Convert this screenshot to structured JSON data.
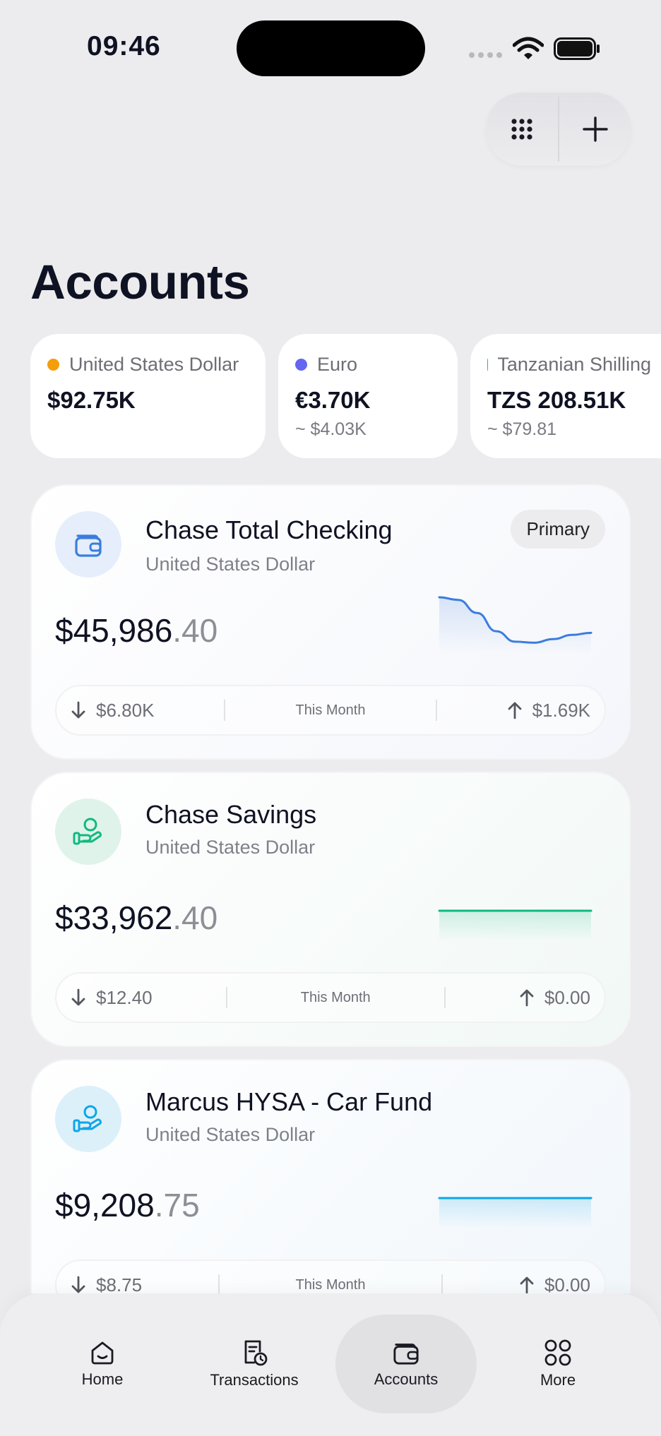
{
  "status_bar": {
    "time": "09:46"
  },
  "page": {
    "title": "Accounts"
  },
  "currencies": [
    {
      "name": "United States Dollar",
      "amount": "$92.75K",
      "approx": "",
      "dot_color": "#f59e0b"
    },
    {
      "name": "Euro",
      "amount": "€3.70K",
      "approx": "~ $4.03K",
      "dot_color": "#6366f1"
    },
    {
      "name": "Tanzanian Shilling",
      "amount": "TZS 208.51K",
      "approx": "~ $79.81",
      "dot_color": "#14b8a6"
    }
  ],
  "accounts": [
    {
      "name": "Chase Total Checking",
      "currency": "United States Dollar",
      "badge": "Primary",
      "balance_main": "$45,986",
      "balance_cents": ".40",
      "out_amount": "$6.80K",
      "period": "This Month",
      "in_amount": "$1.69K",
      "accent": "#3b7ddd",
      "icon": "wallet-icon",
      "trend": [
        0.0,
        0.05,
        0.3,
        0.65,
        0.85,
        0.87,
        0.8,
        0.72,
        0.68
      ]
    },
    {
      "name": "Chase Savings",
      "currency": "United States Dollar",
      "badge": "",
      "balance_main": "$33,962",
      "balance_cents": ".40",
      "out_amount": "$12.40",
      "period": "This Month",
      "in_amount": "$0.00",
      "accent": "#10b981",
      "icon": "hand-coin-icon",
      "trend": [
        0.5,
        0.5,
        0.5,
        0.5,
        0.5,
        0.5,
        0.5,
        0.5,
        0.5
      ]
    },
    {
      "name": "Marcus HYSA - Car Fund",
      "currency": "United States Dollar",
      "badge": "",
      "balance_main": "$9,208",
      "balance_cents": ".75",
      "out_amount": "$8.75",
      "period": "This Month",
      "in_amount": "$0.00",
      "accent": "#0ea5e9",
      "icon": "hand-coin-icon",
      "trend": [
        0.5,
        0.5,
        0.5,
        0.5,
        0.5,
        0.5,
        0.5,
        0.5,
        0.5
      ]
    }
  ],
  "tabs": [
    {
      "label": "Home",
      "icon": "home-icon",
      "active": false
    },
    {
      "label": "Transactions",
      "icon": "receipt-clock-icon",
      "active": false
    },
    {
      "label": "Accounts",
      "icon": "wallet-icon",
      "active": true
    },
    {
      "label": "More",
      "icon": "grid-circles-icon",
      "active": false
    }
  ]
}
